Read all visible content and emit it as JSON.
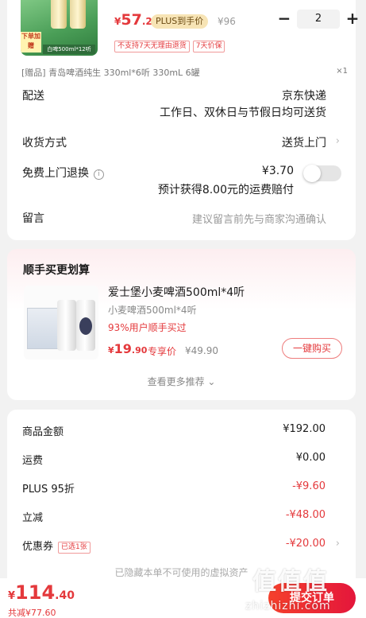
{
  "cart_item": {
    "thumb_tag": "下单加赠",
    "thumb_strip": "白啤500ml*12听",
    "price_symbol": "¥",
    "price_int": "57",
    "price_dec": ".2",
    "plus_label": "PLUS到手价",
    "original_price": "¥96",
    "quantity": "2",
    "minus_symbol": "−",
    "plus_symbol": "+",
    "badges": [
      "不支持7天无理由退货",
      "7天价保"
    ],
    "gift_text": "[赠品] 青岛啤酒纯生 330ml*6听 330mL 6罐",
    "gift_count": "×1"
  },
  "delivery": {
    "label": "配送",
    "carrier": "京东快递",
    "schedule": "工作日、双休日与节假日均可送货"
  },
  "receive": {
    "label": "收货方式",
    "value": "送货上门"
  },
  "return_service": {
    "label": "免费上门退换",
    "info_icon": "i",
    "price": "¥3.70",
    "note": "预计获得8.00元的运费赔付"
  },
  "message": {
    "label": "留言",
    "placeholder": "建议留言前先与商家沟通确认"
  },
  "upsell": {
    "title": "顺手买更划算",
    "product_name": "爱士堡小麦啤酒500ml*4听",
    "product_sub": "小麦啤酒500ml*4听",
    "rate": "93%用户顺手买过",
    "price_symbol": "¥",
    "price_int": "19",
    "price_dec": ".90",
    "price_tag": "专享价",
    "original_price": "¥49.90",
    "buy_label": "一键购买",
    "more_label": "查看更多推荐 ⌄"
  },
  "summary": {
    "rows": [
      {
        "label": "商品金额",
        "value": "¥192.00"
      },
      {
        "label": "运费",
        "value": "¥0.00"
      },
      {
        "label": "PLUS 95折",
        "value": "-¥9.60"
      },
      {
        "label": "立减",
        "value": "-¥48.00"
      },
      {
        "label": "优惠券",
        "value": "-¥20.00",
        "chip": "已选1张"
      }
    ],
    "hidden_note": "已隐藏本单不可使用的虚拟资产"
  },
  "bottom_bar": {
    "total_symbol": "¥",
    "total_int": "114",
    "total_dec": ".40",
    "saved": "共减¥77.60",
    "submit_label": "提交订单"
  },
  "watermark": {
    "logo": "值值值",
    "url": "zhizhizhi.com"
  },
  "colors": {
    "accent_red": "#e4393c",
    "plus_gold": "#f7e4b5",
    "background": "#f2f2f2"
  }
}
